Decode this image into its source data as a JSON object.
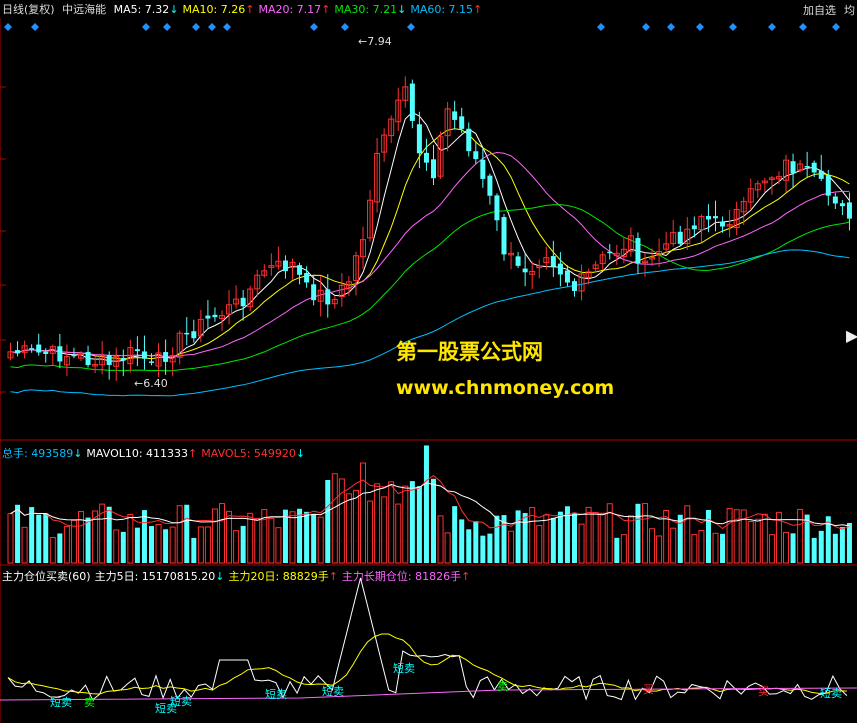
{
  "header": {
    "period": "日线(复权)",
    "stock_name": "中远海能",
    "ma": [
      {
        "label": "MA5: 7.32",
        "arrow": "↓",
        "color": "#ffffff",
        "arrow_color": "#00ffff"
      },
      {
        "label": "MA10: 7.26",
        "arrow": "↑",
        "color": "#ffff00",
        "arrow_color": "#ff3030"
      },
      {
        "label": "MA20: 7.17",
        "arrow": "↑",
        "color": "#ff66ff",
        "arrow_color": "#ff3030"
      },
      {
        "label": "MA30: 7.21",
        "arrow": "↓",
        "color": "#00e600",
        "arrow_color": "#00ffff"
      },
      {
        "label": "MA60: 7.15",
        "arrow": "↑",
        "color": "#00bfff",
        "arrow_color": "#ff3030"
      }
    ],
    "buttons": {
      "add_watch": "加自选",
      "more": "均"
    }
  },
  "price_panel": {
    "high_label": "7.94",
    "low_label": "6.40"
  },
  "volume_panel": {
    "items": [
      {
        "label": "总手: 493589",
        "arrow": "↓",
        "color": "#00bfff",
        "arrow_color": "#00ffff"
      },
      {
        "label": "MAVOL10: 411333",
        "arrow": "↑",
        "color": "#ffffff",
        "arrow_color": "#ff3030"
      },
      {
        "label": "MAVOL5: 549920",
        "arrow": "↓",
        "color": "#ff3030",
        "arrow_color": "#00ffff"
      }
    ]
  },
  "indicator_panel": {
    "items": [
      {
        "label": "主力仓位买卖(60)",
        "arrow": "",
        "color": "#ffffff",
        "arrow_color": "#ffffff"
      },
      {
        "label": "主力5日: 15170815.20",
        "arrow": "↓",
        "color": "#ffffff",
        "arrow_color": "#00ffff"
      },
      {
        "label": "主力20日: 88829手",
        "arrow": "↑",
        "color": "#ffff00",
        "arrow_color": "#ff3030"
      },
      {
        "label": "主力长期仓位: 81826手",
        "arrow": "↑",
        "color": "#ff66ff",
        "arrow_color": "#ff3030"
      }
    ],
    "signals": [
      {
        "text": "短卖",
        "color": "#00ffff"
      },
      {
        "text": "卖",
        "color": "#00ff00"
      },
      {
        "text": "短卖",
        "color": "#00ffff"
      },
      {
        "text": "短卖",
        "color": "#00ffff"
      },
      {
        "text": "短卖",
        "color": "#00ffff"
      },
      {
        "text": "短卖",
        "color": "#00ffff"
      },
      {
        "text": "短卖",
        "color": "#00ffff"
      },
      {
        "text": "卖",
        "color": "#00ff00"
      },
      {
        "text": "买",
        "color": "#ff3030"
      },
      {
        "text": "买",
        "color": "#ff3030"
      },
      {
        "text": "短卖",
        "color": "#00ffff"
      }
    ]
  },
  "watermark": {
    "title": "第一股票公式网",
    "url": "www.chnmoney.com"
  }
}
